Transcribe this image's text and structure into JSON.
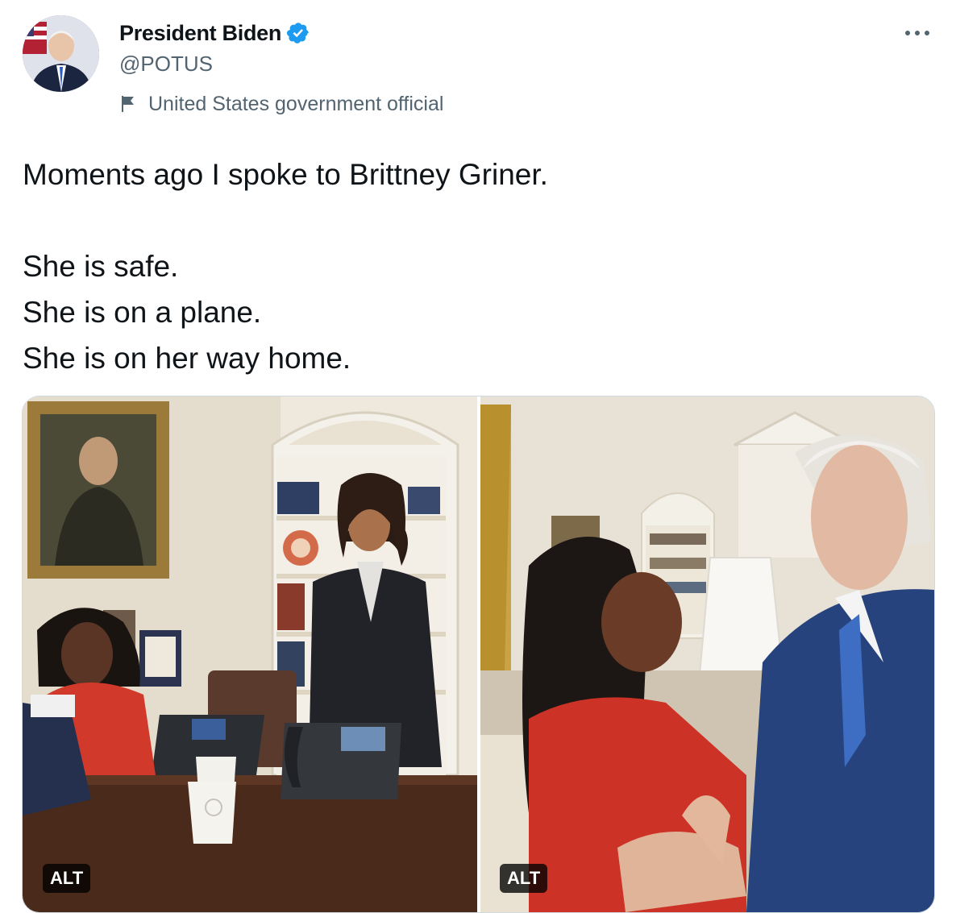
{
  "author": {
    "display_name": "President Biden",
    "handle": "@POTUS",
    "verified_icon": "verified-badge-icon",
    "label_icon": "flag-icon",
    "label": "United States government official",
    "avatar": "avatar-photo"
  },
  "more_icon": "more-options-icon",
  "tweet": {
    "paragraph_1": "Moments ago I spoke to Brittney Griner.",
    "paragraph_2": "She is safe.\nShe is on a plane.\nShe is on her way home."
  },
  "media": {
    "photos": [
      {
        "alt_label": "ALT"
      },
      {
        "alt_label": "ALT"
      }
    ]
  },
  "colors": {
    "text_primary": "#0f1419",
    "text_secondary": "#536471",
    "verified_blue": "#1d9bf0",
    "border": "#cfd9de"
  }
}
